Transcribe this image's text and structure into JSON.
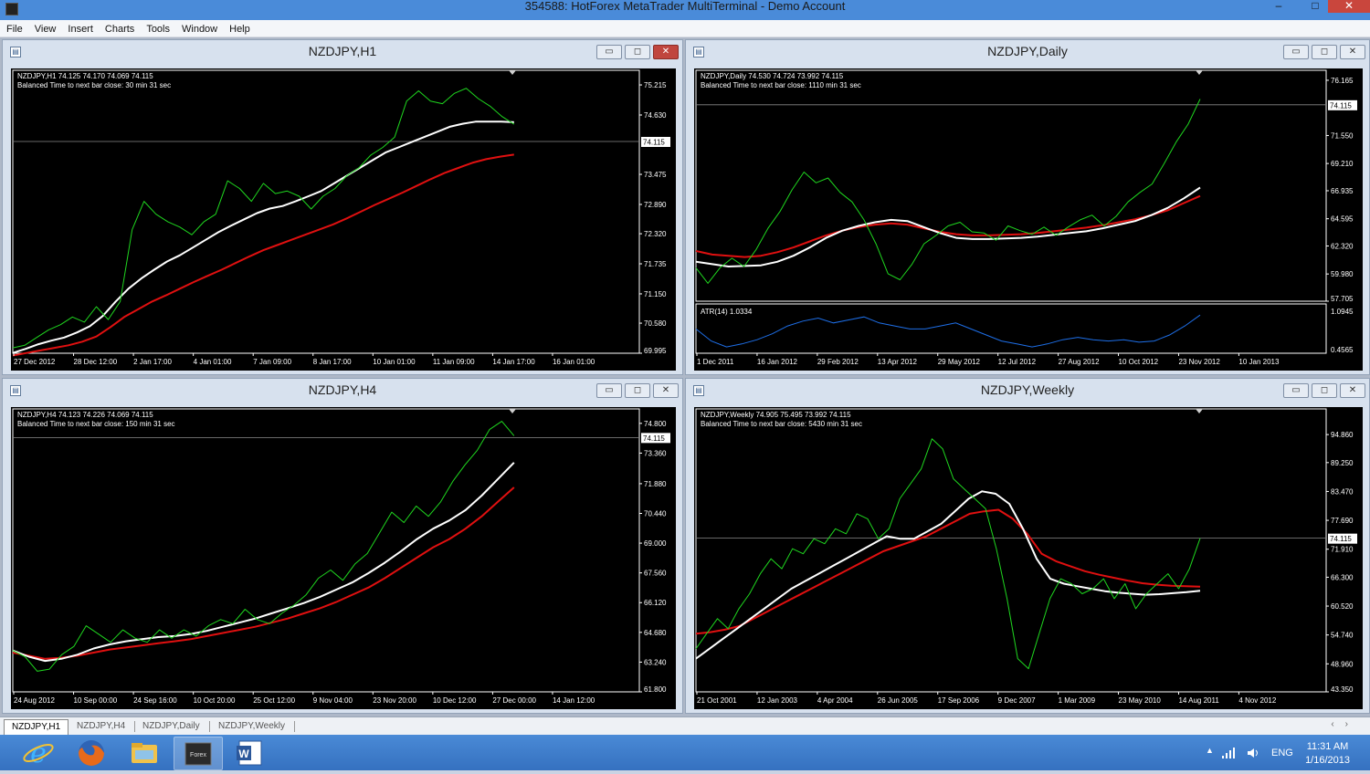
{
  "window": {
    "title": "354588: HotForex MetaTrader MultiTerminal - Demo Account",
    "controls": {
      "minimize": "–",
      "maximize": "□",
      "close": "✕"
    }
  },
  "menu": [
    "File",
    "View",
    "Insert",
    "Charts",
    "Tools",
    "Window",
    "Help"
  ],
  "charts": [
    {
      "id": "h1",
      "title": "NZDJPY,H1",
      "info_line1": "NZDJPY,H1  74.125 74.170 74.069 74.115",
      "info_line2": "Balanced Time to next bar close: 30 min 31 sec",
      "price_tag": "74.115",
      "y_labels": [
        "75.215",
        "74.630",
        "74.115",
        "73.475",
        "72.890",
        "72.320",
        "71.735",
        "71.150",
        "70.580",
        "69.995"
      ],
      "x_labels": [
        "27 Dec 2012",
        "28 Dec 12:00",
        "2 Jan 17:00",
        "4 Jan 01:00",
        "7 Jan 09:00",
        "8 Jan 17:00",
        "10 Jan 01:00",
        "11 Jan 09:00",
        "14 Jan 17:00",
        "16 Jan 01:00"
      ],
      "ylim": [
        69.995,
        75.5
      ],
      "current": 74.115,
      "active": true,
      "series": {
        "price": [
          70.1,
          70.15,
          70.3,
          70.45,
          70.55,
          70.7,
          70.6,
          70.9,
          70.65,
          71.0,
          72.4,
          72.95,
          72.7,
          72.55,
          72.45,
          72.3,
          72.55,
          72.7,
          73.35,
          73.2,
          72.95,
          73.3,
          73.1,
          73.15,
          73.05,
          72.8,
          73.05,
          73.2,
          73.45,
          73.6,
          73.85,
          74.0,
          74.2,
          74.9,
          75.1,
          74.9,
          74.85,
          75.05,
          75.15,
          74.95,
          74.8,
          74.6,
          74.45
        ],
        "ma_white": [
          70.0,
          70.08,
          70.17,
          70.24,
          70.3,
          70.4,
          70.52,
          70.72,
          71.0,
          71.25,
          71.45,
          71.62,
          71.78,
          71.9,
          72.05,
          72.2,
          72.35,
          72.48,
          72.6,
          72.72,
          72.81,
          72.86,
          72.95,
          73.05,
          73.15,
          73.3,
          73.45,
          73.6,
          73.75,
          73.9,
          74.0,
          74.1,
          74.2,
          74.3,
          74.4,
          74.46,
          74.5,
          74.5,
          74.5,
          74.49
        ],
        "ma_red": [
          69.95,
          70.0,
          70.05,
          70.1,
          70.15,
          70.22,
          70.32,
          70.5,
          70.7,
          70.85,
          71.0,
          71.12,
          71.25,
          71.38,
          71.5,
          71.62,
          71.75,
          71.88,
          72.0,
          72.1,
          72.2,
          72.3,
          72.4,
          72.5,
          72.62,
          72.75,
          72.88,
          73.0,
          73.12,
          73.25,
          73.38,
          73.5,
          73.6,
          73.7,
          73.77,
          73.82,
          73.86
        ]
      }
    },
    {
      "id": "daily",
      "title": "NZDJPY,Daily",
      "info_line1": "NZDJPY,Daily  74.530 74.724 73.992 74.115",
      "info_line2": "Balanced Time to next bar close: 1110 min 31 sec",
      "price_tag": "74.115",
      "y_labels": [
        "76.165",
        "74.115",
        "71.550",
        "69.210",
        "66.935",
        "64.595",
        "62.320",
        "59.980",
        "57.705"
      ],
      "x_labels": [
        "1 Dec 2011",
        "16 Jan 2012",
        "29 Feb 2012",
        "13 Apr 2012",
        "29 May 2012",
        "12 Jul 2012",
        "27 Aug 2012",
        "10 Oct 2012",
        "23 Nov 2012",
        "10 Jan 2013"
      ],
      "ylim": [
        57.705,
        77.0
      ],
      "current": 74.115,
      "active": false,
      "series": {
        "price": [
          60.5,
          59.2,
          60.5,
          61.3,
          60.6,
          62.0,
          63.8,
          65.2,
          67.0,
          68.5,
          67.6,
          68.0,
          66.8,
          66.0,
          64.5,
          62.5,
          60.0,
          59.5,
          60.8,
          62.5,
          63.2,
          64.0,
          64.3,
          63.5,
          63.4,
          62.8,
          64.0,
          63.6,
          63.3,
          63.9,
          63.2,
          63.9,
          64.5,
          64.9,
          64.0,
          64.8,
          66.0,
          66.8,
          67.5,
          69.2,
          71.0,
          72.5,
          74.6
        ],
        "ma_white": [
          61.0,
          60.8,
          60.6,
          60.65,
          60.7,
          61.0,
          61.5,
          62.2,
          63.0,
          63.6,
          64.0,
          64.3,
          64.5,
          64.4,
          63.9,
          63.4,
          63.0,
          62.9,
          62.9,
          62.95,
          63.0,
          63.1,
          63.25,
          63.4,
          63.55,
          63.8,
          64.1,
          64.4,
          64.9,
          65.5,
          66.3,
          67.2
        ],
        "ma_red": [
          61.9,
          61.6,
          61.5,
          61.4,
          61.5,
          61.8,
          62.2,
          62.7,
          63.2,
          63.6,
          63.9,
          64.1,
          64.2,
          64.1,
          63.8,
          63.5,
          63.3,
          63.2,
          63.2,
          63.25,
          63.3,
          63.4,
          63.55,
          63.7,
          63.85,
          64.05,
          64.3,
          64.55,
          64.9,
          65.3,
          65.9,
          66.5
        ]
      },
      "indicator": {
        "label": "ATR(14) 1.0334",
        "y_labels": [
          "1.0945",
          "0.4565"
        ],
        "ylim": [
          0.4565,
          1.0945
        ],
        "values": [
          0.8,
          0.6,
          0.5,
          0.55,
          0.62,
          0.72,
          0.85,
          0.93,
          0.98,
          0.9,
          0.95,
          1.0,
          0.9,
          0.85,
          0.8,
          0.8,
          0.85,
          0.9,
          0.8,
          0.7,
          0.6,
          0.55,
          0.5,
          0.55,
          0.62,
          0.66,
          0.62,
          0.6,
          0.62,
          0.58,
          0.6,
          0.7,
          0.85,
          1.03
        ]
      }
    },
    {
      "id": "h4",
      "title": "NZDJPY,H4",
      "info_line1": "NZDJPY,H4  74.123 74.226 74.069 74.115",
      "info_line2": "Balanced Time to next bar close: 150 min 31 sec",
      "price_tag": "74.115",
      "y_labels": [
        "74.800",
        "74.115",
        "73.360",
        "71.880",
        "70.440",
        "69.000",
        "67.560",
        "66.120",
        "64.680",
        "63.240",
        "61.800"
      ],
      "x_labels": [
        "24 Aug 2012",
        "10 Sep 00:00",
        "24 Sep 16:00",
        "10 Oct 20:00",
        "25 Oct 12:00",
        "9 Nov 04:00",
        "23 Nov 20:00",
        "10 Dec 12:00",
        "27 Dec 00:00",
        "14 Jan 12:00"
      ],
      "ylim": [
        61.8,
        75.5
      ],
      "current": 74.115,
      "active": false,
      "series": {
        "price": [
          63.8,
          63.5,
          62.8,
          62.9,
          63.6,
          64.0,
          65.0,
          64.6,
          64.2,
          64.8,
          64.4,
          64.2,
          64.8,
          64.4,
          64.8,
          64.5,
          65.0,
          65.3,
          65.1,
          65.8,
          65.3,
          65.1,
          65.6,
          66.0,
          66.5,
          67.3,
          67.7,
          67.2,
          68.0,
          68.5,
          69.5,
          70.5,
          70.0,
          70.8,
          70.3,
          71.0,
          72.0,
          72.8,
          73.5,
          74.5,
          74.9,
          74.2
        ],
        "ma_white": [
          63.8,
          63.5,
          63.3,
          63.4,
          63.6,
          63.9,
          64.1,
          64.25,
          64.35,
          64.45,
          64.5,
          64.6,
          64.75,
          64.95,
          65.15,
          65.35,
          65.6,
          65.85,
          66.1,
          66.4,
          66.75,
          67.1,
          67.55,
          68.05,
          68.6,
          69.2,
          69.7,
          70.1,
          70.6,
          71.3,
          72.1,
          72.9
        ],
        "ma_red": [
          63.7,
          63.55,
          63.4,
          63.45,
          63.55,
          63.7,
          63.85,
          63.95,
          64.05,
          64.15,
          64.25,
          64.35,
          64.5,
          64.65,
          64.8,
          64.95,
          65.15,
          65.35,
          65.6,
          65.85,
          66.15,
          66.5,
          66.85,
          67.3,
          67.8,
          68.3,
          68.8,
          69.2,
          69.7,
          70.3,
          71.0,
          71.7
        ]
      }
    },
    {
      "id": "weekly",
      "title": "NZDJPY,Weekly",
      "info_line1": "NZDJPY,Weekly  74.905 75.495 73.992 74.115",
      "info_line2": "Balanced Time to next bar close: 5430 min 31 sec",
      "price_tag": "74.115",
      "y_labels": [
        "94.860",
        "89.250",
        "83.470",
        "77.690",
        "74.115",
        "71.910",
        "66.300",
        "60.520",
        "54.740",
        "48.960",
        "43.350"
      ],
      "x_labels": [
        "21 Oct 2001",
        "12 Jan 2003",
        "4 Apr 2004",
        "26 Jun 2005",
        "17 Sep 2006",
        "9 Dec 2007",
        "1 Mar 2009",
        "23 May 2010",
        "14 Aug 2011",
        "4 Nov 2012"
      ],
      "ylim": [
        43.35,
        100.0
      ],
      "current": 74.115,
      "active": false,
      "series": {
        "price": [
          52,
          55,
          58,
          56,
          60,
          63,
          67,
          70,
          68,
          72,
          71,
          74,
          73,
          76,
          75,
          79,
          78,
          74,
          76,
          82,
          85,
          88,
          94,
          92,
          86,
          84,
          82,
          80,
          72,
          62,
          50,
          48,
          55,
          62,
          66,
          65,
          63,
          64,
          66,
          62,
          65,
          60,
          63,
          65,
          67,
          64,
          68,
          74.1
        ],
        "ma_white": [
          50,
          52,
          54,
          56,
          58,
          60,
          62,
          64,
          65.5,
          67,
          68.5,
          70,
          71.5,
          73,
          74.5,
          74,
          74,
          75.5,
          77,
          79.5,
          82,
          83.5,
          83,
          81,
          76,
          70,
          66,
          65,
          64.5,
          64,
          63.5,
          63.2,
          63,
          62.8,
          62.9,
          63.1,
          63.3,
          63.6
        ],
        "ma_red": [
          55,
          55.3,
          55.8,
          56.5,
          58,
          59.5,
          61,
          62.5,
          64,
          65.5,
          67,
          68.5,
          70,
          71.5,
          72.5,
          73.5,
          74.5,
          76,
          77.5,
          79,
          79.5,
          79.8,
          78,
          75,
          71,
          69.5,
          68.5,
          67.5,
          66.8,
          66.2,
          65.6,
          65.1,
          64.8,
          64.6,
          64.5,
          64.4
        ]
      }
    }
  ],
  "tabs": [
    "NZDJPY,H1",
    "NZDJPY,H4",
    "NZDJPY,Daily",
    "NZDJPY,Weekly"
  ],
  "taskbar": {
    "apps": [
      "internet-explorer",
      "firefox",
      "file-explorer",
      "forex-terminal",
      "word"
    ],
    "forex_label": "Forex",
    "lang": "ENG",
    "time": "11:31 AM",
    "date": "1/16/2013"
  },
  "colors": {
    "price": "#1fd61f",
    "ma_white": "#ffffff",
    "ma_red": "#e01010",
    "atr": "#1e6fe8",
    "taskbar": "#3d7acb"
  }
}
